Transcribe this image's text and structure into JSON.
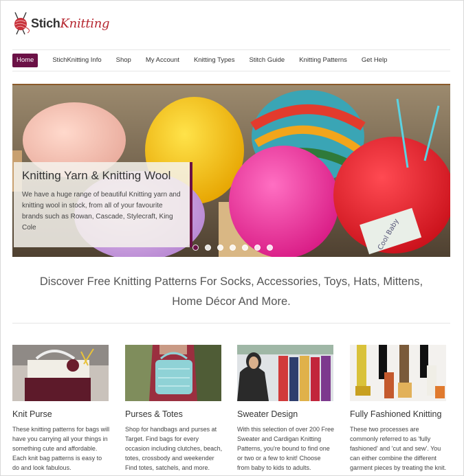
{
  "logo": {
    "part1": "Stich",
    "part2": "Knitting"
  },
  "nav": {
    "items": [
      {
        "label": "Home",
        "active": true
      },
      {
        "label": "StichKnitting Info"
      },
      {
        "label": "Shop"
      },
      {
        "label": "My Account"
      },
      {
        "label": "Knitting Types"
      },
      {
        "label": "Stitch Guide"
      },
      {
        "label": "Knitting Patterns"
      },
      {
        "label": "Get Help"
      }
    ]
  },
  "hero": {
    "title": "Knitting Yarn & Knitting Wool",
    "text": "We have a huge range of beautiful Knitting yarn and knitting wool in stock, from all of your favourite brands such as Rowan, Cascade, Stylecraft, King Cole",
    "slide_count": 7,
    "active_slide": 1,
    "label_text": "Cool Baby"
  },
  "tagline": {
    "line1": "Discover Free Knitting Patterns For Socks, Accessories, Toys, Hats, Mittens,",
    "line2": "Home Décor And More."
  },
  "cards": [
    {
      "title": "Knit Purse",
      "text": "These knitting patterns for bags will have you carrying all your things in something cute and affordable. Each knit bag patterns is easy to do and look fabulous."
    },
    {
      "title": "Purses & Totes",
      "text": "Shop for handbags and purses at Target. Find bags for every occasion including clutches, beach, totes, crossbody and weekender Find totes, satchels, and more."
    },
    {
      "title": "Sweater Design",
      "text": "With this selection of over 200 Free Sweater and Cardigan Knitting Patterns, you're bound to find one or two or a few to knit! Choose from baby to kids to adults."
    },
    {
      "title": "Fully Fashioned Knitting",
      "text": "These two processes are commonly referred to as 'fully fashioned' and 'cut and sew'. You can either combine the different garment pieces by treating the knit."
    }
  ],
  "colors": {
    "accent": "#6b1146",
    "logo_red": "#b5262f"
  }
}
